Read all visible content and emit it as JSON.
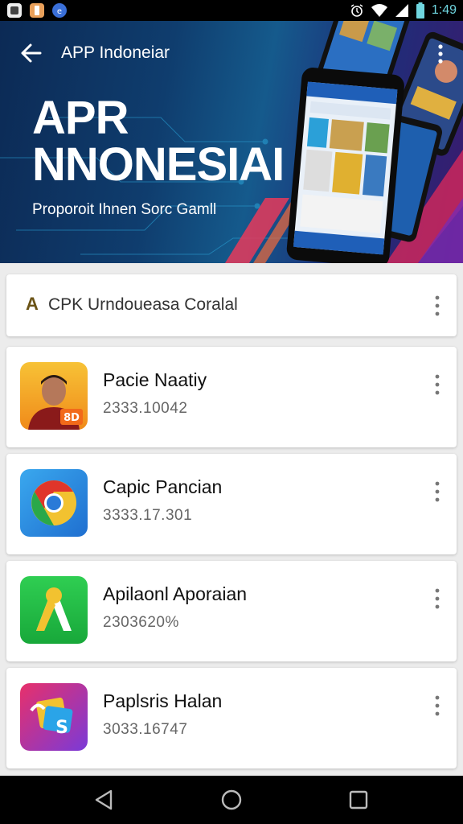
{
  "status_bar": {
    "time": "1:49",
    "icons": [
      "notification-app-icon",
      "notification-app-icon",
      "notification-app-icon",
      "alarm-icon",
      "wifi-icon",
      "signal-icon",
      "battery-icon"
    ]
  },
  "toolbar": {
    "title": "APP Indoneiar",
    "back_icon": "arrow-left-icon",
    "overflow_icon": "more-vert-icon"
  },
  "hero": {
    "title": "APR NNONESIAI",
    "subtitle": "Proporoit Ihnen Sorc Gamll"
  },
  "search_card": {
    "logo": "A",
    "text": "CPK Urndoueasa Coralal",
    "overflow_icon": "more-vert-icon"
  },
  "apps": [
    {
      "name": "Pacie Naatiy",
      "meta": "2333.10042",
      "icon": "portrait-app-icon",
      "badge": "8D"
    },
    {
      "name": "Capic Pancian",
      "meta": "3333.17.301",
      "icon": "chrome-icon"
    },
    {
      "name": "Apilaonl Aporaian",
      "meta": "2303620%",
      "icon": "green-a-app-icon"
    },
    {
      "name": "Paplsris Halan",
      "meta": "3033.16747",
      "icon": "colorful-s-app-icon"
    }
  ],
  "nav": {
    "back_icon": "nav-back-icon",
    "home_icon": "nav-home-icon",
    "recents_icon": "nav-recents-icon"
  },
  "colors": {
    "header_dark": "#0c2a55",
    "header_accent": "#e63a5a",
    "status_time": "#6fd6e0",
    "background": "#ececec"
  }
}
